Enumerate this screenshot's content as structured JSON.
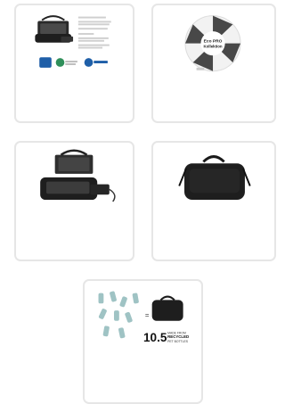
{
  "gallery": {
    "thumb1": {
      "badges": [
        "recycled",
        "sustainably",
        "vivid"
      ]
    },
    "thumb2": {
      "center_title": "Eco PRO",
      "center_subtitle": "Kollektion"
    },
    "thumb5": {
      "big_number": "10.5",
      "caption_line1": "MADE FROM",
      "caption_line2": "RECYCLED",
      "caption_line3": "PET BOTTLES",
      "equals": "="
    }
  },
  "colors": {
    "bag": "#1e1e1e",
    "bottle": "#9fc3c4",
    "badge_blue": "#1f5fa8",
    "badge_green": "#2f8f5a",
    "border": "#e6e6e6"
  }
}
